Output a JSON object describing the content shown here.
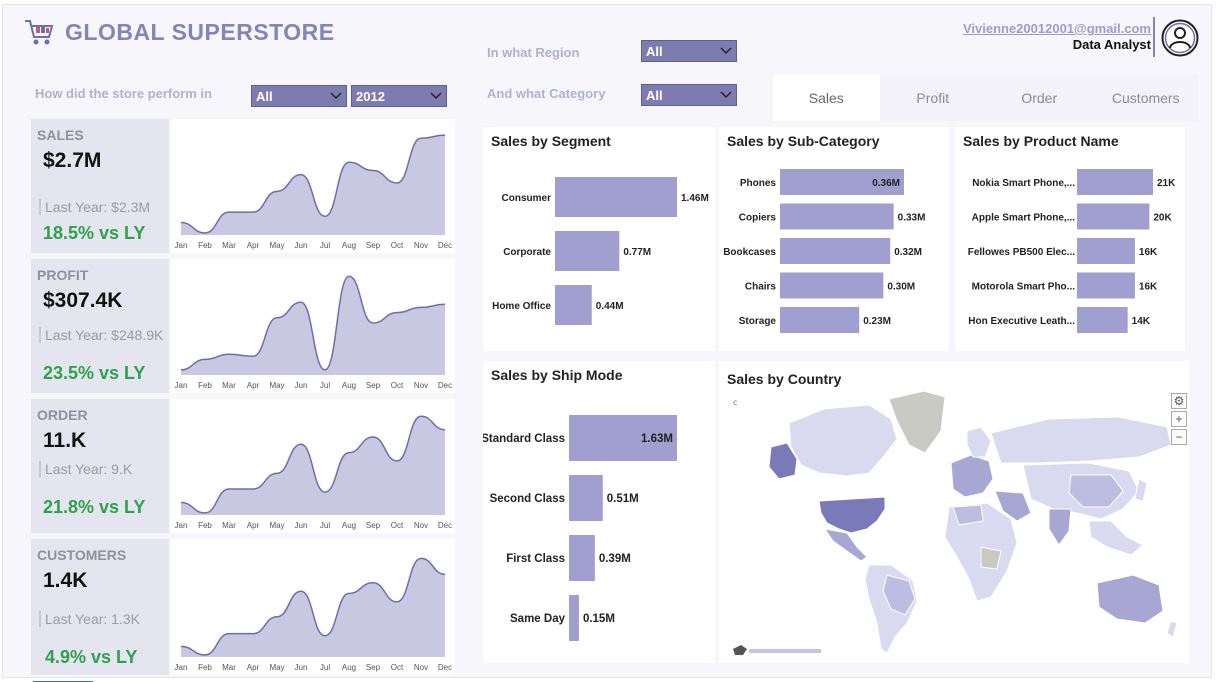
{
  "header": {
    "title": "GLOBAL SUPERSTORE",
    "email": "Vivienne20012001@gmail.com",
    "role": "Data Analyst"
  },
  "filters": {
    "perform_label": "How did the store perform in",
    "perform_value": "All",
    "year_value": "2012",
    "region_label": "In what Region",
    "region_value": "All",
    "category_label": "And what Category",
    "category_value": "All"
  },
  "tabs": [
    {
      "label": "Sales",
      "active": true
    },
    {
      "label": "Profit",
      "active": false
    },
    {
      "label": "Order",
      "active": false
    },
    {
      "label": "Customers",
      "active": false
    }
  ],
  "months": [
    "Jan",
    "Feb",
    "Mar",
    "Apr",
    "May",
    "Jun",
    "Jul",
    "Aug",
    "Sep",
    "Oct",
    "Nov",
    "Dec"
  ],
  "kpis": [
    {
      "label": "SALES",
      "value": "$2.7M",
      "last_year": "Last Year: $2.3M",
      "change": "18.5% vs LY",
      "trend": [
        0.12,
        0.02,
        0.22,
        0.22,
        0.42,
        0.58,
        0.18,
        0.7,
        0.62,
        0.5,
        0.93,
        0.96
      ]
    },
    {
      "label": "PROFIT",
      "value": "$307.4K",
      "last_year": "Last Year: $248.9K",
      "change": "23.5% vs LY",
      "trend": [
        0.05,
        0.15,
        0.2,
        0.18,
        0.55,
        0.7,
        0.05,
        0.95,
        0.5,
        0.6,
        0.65,
        0.68
      ]
    },
    {
      "label": "ORDER",
      "value": "11.K",
      "last_year": "Last Year: 9.K",
      "change": "21.8% vs LY",
      "trend": [
        0.12,
        0.02,
        0.25,
        0.25,
        0.4,
        0.68,
        0.22,
        0.6,
        0.75,
        0.52,
        0.95,
        0.82
      ]
    },
    {
      "label": "CUSTOMERS",
      "value": "1.4K",
      "last_year": "Last Year: 1.3K",
      "change": "4.9% vs LY",
      "trend": [
        0.1,
        0.02,
        0.22,
        0.22,
        0.38,
        0.62,
        0.2,
        0.6,
        0.7,
        0.52,
        0.93,
        0.78
      ]
    }
  ],
  "chart_data": [
    {
      "type": "bar",
      "title": "Sales by Segment",
      "orientation": "horizontal",
      "categories": [
        "Consumer",
        "Corporate",
        "Home Office"
      ],
      "values": [
        1.46,
        0.77,
        0.44
      ],
      "labels": [
        "1.46M",
        "0.77M",
        "0.44M"
      ]
    },
    {
      "type": "bar",
      "title": "Sales by Sub-Category",
      "orientation": "horizontal",
      "categories": [
        "Phones",
        "Copiers",
        "Bookcases",
        "Chairs",
        "Storage"
      ],
      "values": [
        0.36,
        0.33,
        0.32,
        0.3,
        0.23
      ],
      "labels": [
        "0.36M",
        "0.33M",
        "0.32M",
        "0.30M",
        "0.23M"
      ]
    },
    {
      "type": "bar",
      "title": "Sales by Product Name",
      "orientation": "horizontal",
      "categories": [
        "Nokia Smart Phone,...",
        "Apple Smart Phone,...",
        "Fellowes PB500 Elec...",
        "Motorola Smart Pho...",
        "Hon Executive Leath..."
      ],
      "values": [
        21,
        20,
        16,
        16,
        14
      ],
      "labels": [
        "21K",
        "20K",
        "16K",
        "16K",
        "14K"
      ]
    },
    {
      "type": "bar",
      "title": "Sales by Ship Mode",
      "orientation": "horizontal",
      "categories": [
        "Standard Class",
        "Second Class",
        "First Class",
        "Same Day"
      ],
      "values": [
        1.63,
        0.51,
        0.39,
        0.15
      ],
      "labels": [
        "1.63M",
        "0.51M",
        "0.39M",
        "0.15M"
      ]
    }
  ],
  "map": {
    "title": "Sales by Country",
    "colors": {
      "land": "#d9d9f0",
      "high": "#7b7ab8",
      "mid": "#a8a7d4",
      "ice": "#c9cac4",
      "water": "#ffffff"
    }
  },
  "colors": {
    "bar": "#a09fcf",
    "spark_fill": "#c9c8e2",
    "spark_line": "#6e6ea8",
    "accent": "#8584b8",
    "positive": "#2ca24a"
  }
}
